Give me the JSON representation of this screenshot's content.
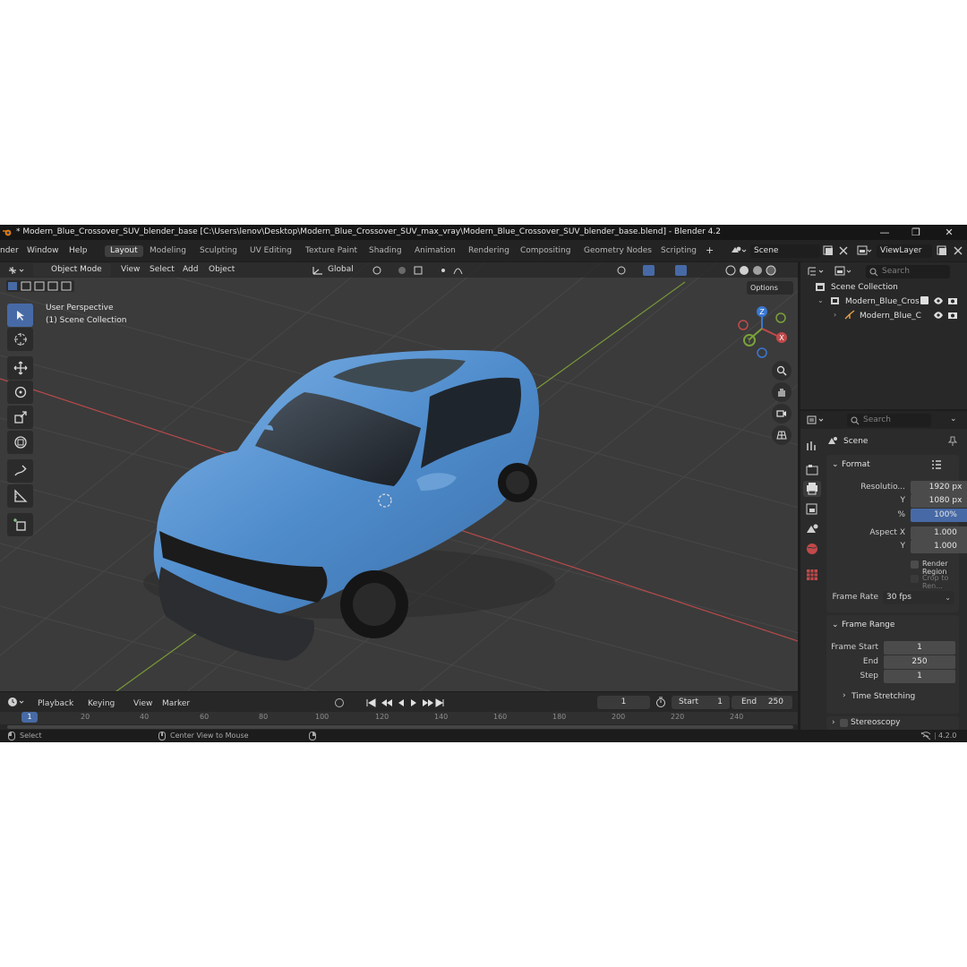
{
  "window": {
    "title": "* Modern_Blue_Crossover_SUV_blender_base [C:\\Users\\lenov\\Desktop\\Modern_Blue_Crossover_SUV_max_vray\\Modern_Blue_Crossover_SUV_blender_base.blend] - Blender 4.2",
    "minimize": "—",
    "maximize": "❐",
    "close": "✕"
  },
  "menu": {
    "items": [
      "nder",
      "Window",
      "Help"
    ],
    "workspaces": [
      "Layout",
      "Modeling",
      "Sculpting",
      "UV Editing",
      "Texture Paint",
      "Shading",
      "Animation",
      "Rendering",
      "Compositing",
      "Geometry Nodes",
      "Scripting"
    ],
    "active_workspace": "Layout",
    "add_workspace": "+",
    "scene": "Scene",
    "view_layer": "ViewLayer"
  },
  "viewport_header": {
    "mode": "Object Mode",
    "menus": [
      "View",
      "Select",
      "Add",
      "Object"
    ],
    "transform_orientation": "Global",
    "options": "Options"
  },
  "viewport": {
    "view_name": "User Perspective",
    "collection": "(1) Scene Collection",
    "gizmo_axes": {
      "z": "Z",
      "x": "X",
      "y": "Y"
    }
  },
  "outliner": {
    "search_placeholder": "Search",
    "root": "Scene Collection",
    "items": [
      {
        "label": "Modern_Blue_Cros"
      },
      {
        "label": "Modern_Blue_C"
      }
    ]
  },
  "properties": {
    "search_placeholder": "Search",
    "scene_label": "Scene",
    "format": {
      "header": "Format",
      "resolution_x_label": "Resolutio...",
      "resolution_x": "1920 px",
      "resolution_y_label": "Y",
      "resolution_y": "1080 px",
      "percent_label": "%",
      "percent": "100%",
      "aspect_x_label": "Aspect X",
      "aspect_x": "1.000",
      "aspect_y_label": "Y",
      "aspect_y": "1.000",
      "render_region": "Render Region",
      "crop": "Crop to Ren...",
      "frame_rate_label": "Frame Rate",
      "frame_rate": "30 fps"
    },
    "frame_range": {
      "header": "Frame Range",
      "start_label": "Frame Start",
      "start": "1",
      "end_label": "End",
      "end": "250",
      "step_label": "Step",
      "step": "1",
      "time_stretching": "Time Stretching"
    },
    "stereoscopy": "Stereoscopy"
  },
  "timeline": {
    "menus": [
      "Playback",
      "Keying",
      "View",
      "Marker"
    ],
    "current_frame": "1",
    "start_label": "Start",
    "start": "1",
    "end_label": "End",
    "end": "250",
    "ticks": [
      "1",
      "20",
      "40",
      "60",
      "80",
      "100",
      "120",
      "140",
      "160",
      "180",
      "200",
      "220",
      "240"
    ]
  },
  "statusbar": {
    "left": "Select",
    "middle": "Center View to Mouse",
    "version": "4.2.0"
  },
  "colors": {
    "accent": "#476aa6",
    "car_body": "#4a86c8",
    "x_axis": "#c2494a",
    "y_axis": "#7aa23a",
    "z_axis": "#3a78d2"
  }
}
